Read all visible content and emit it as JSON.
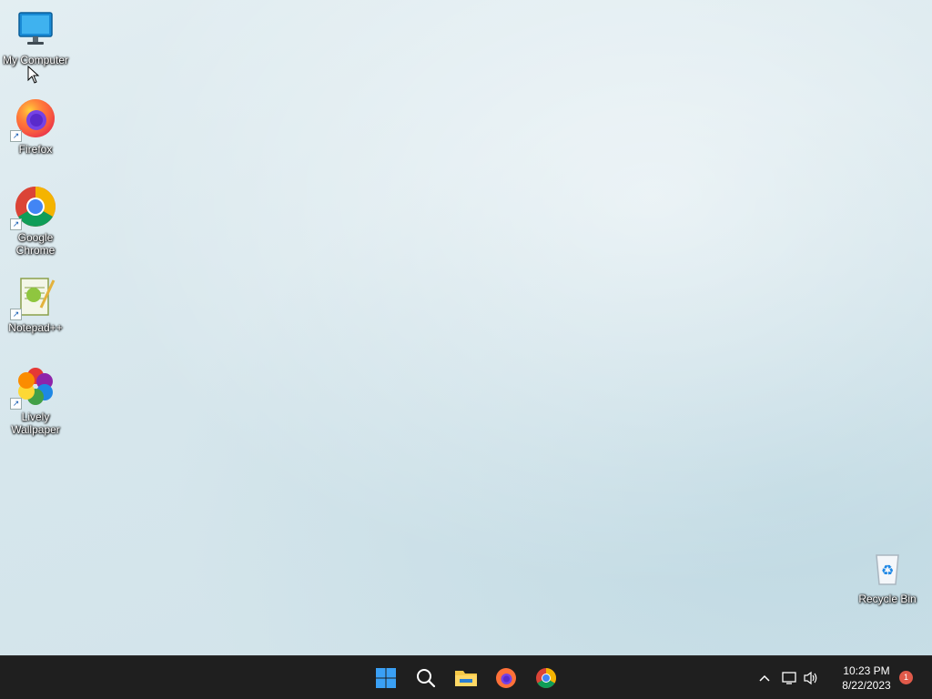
{
  "desktop": {
    "icons": [
      {
        "label": "My Computer",
        "icon": "monitor-icon"
      },
      {
        "label": "Firefox",
        "icon": "firefox-icon"
      },
      {
        "label": "Google Chrome",
        "icon": "chrome-icon"
      },
      {
        "label": "Notepad++",
        "icon": "notepadpp-icon"
      },
      {
        "label": "Lively Wallpaper",
        "icon": "lively-wallpaper-icon"
      },
      {
        "label": "Recycle Bin",
        "icon": "recycle-bin-icon"
      }
    ]
  },
  "taskbar": {
    "apps": [
      {
        "icon": "start-windows-icon"
      },
      {
        "icon": "search-icon"
      },
      {
        "icon": "file-explorer-icon"
      },
      {
        "icon": "firefox-icon"
      },
      {
        "icon": "chrome-icon"
      }
    ],
    "tray": {
      "icons": [
        "chevron-up-icon",
        "network-icon",
        "speaker-icon"
      ]
    },
    "clock": {
      "time": "10:23 PM",
      "date": "8/22/2023"
    },
    "notifications": {
      "count": "1"
    }
  },
  "colors": {
    "taskbar_bg": "#1f1f1f",
    "notification_badge": "#e05a4a",
    "windows_blue": "#1e90ff"
  }
}
